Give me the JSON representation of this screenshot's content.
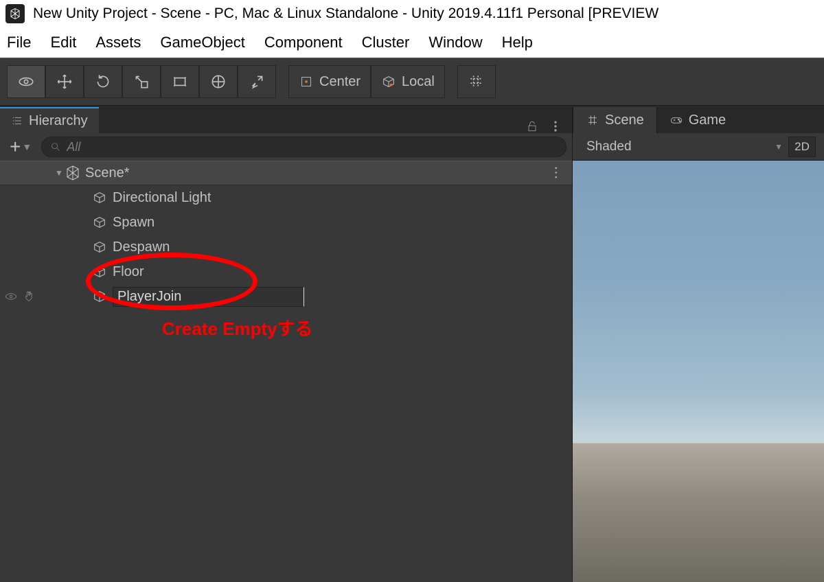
{
  "titlebar": {
    "title": "New Unity Project - Scene - PC, Mac & Linux Standalone - Unity 2019.4.11f1 Personal [PREVIEW"
  },
  "menubar": {
    "items": [
      "File",
      "Edit",
      "Assets",
      "GameObject",
      "Component",
      "Cluster",
      "Window",
      "Help"
    ]
  },
  "toolbar": {
    "pivot_label": "Center",
    "space_label": "Local"
  },
  "hierarchy": {
    "tab_label": "Hierarchy",
    "search_placeholder": "All",
    "scene_name": "Scene*",
    "items": [
      {
        "name": "Directional Light"
      },
      {
        "name": "Spawn"
      },
      {
        "name": "Despawn"
      },
      {
        "name": "Floor"
      },
      {
        "name": "PlayerJoin",
        "editing": true
      }
    ]
  },
  "scene_panel": {
    "tabs": {
      "scene": "Scene",
      "game": "Game"
    },
    "shading_mode": "Shaded",
    "button_2d": "2D"
  },
  "annotation": {
    "text": "Create Emptyする"
  }
}
